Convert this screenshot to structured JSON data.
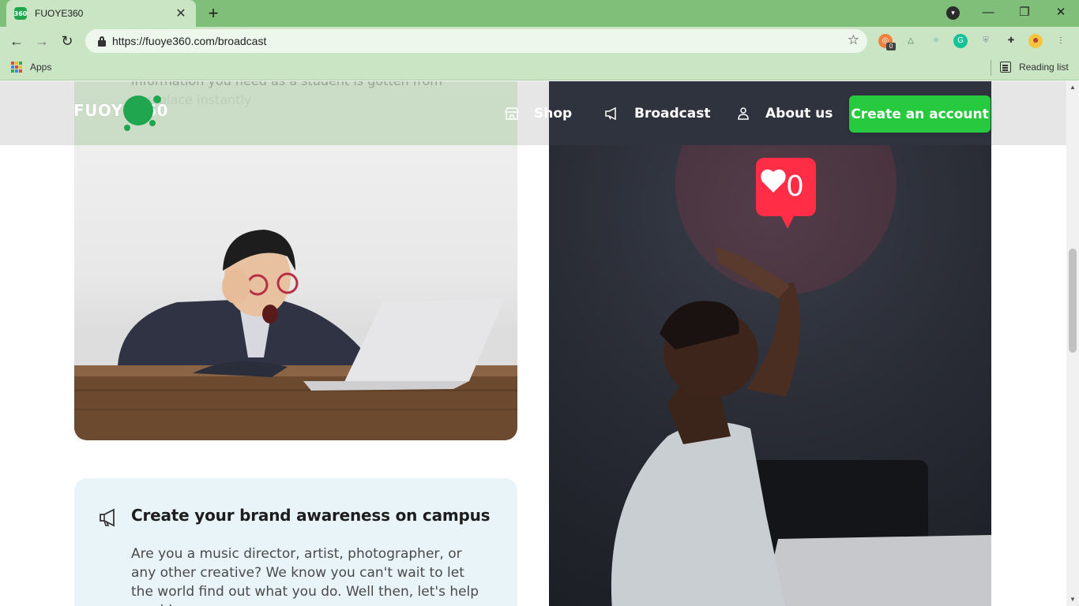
{
  "browser": {
    "tab_title": "FUOYE360",
    "tab_favicon_text": "360",
    "new_tab_label": "+",
    "close_tab_label": "✕",
    "url": "https://fuoye360.com/broadcast",
    "bookmarks": {
      "apps_label": "Apps",
      "reading_list_label": "Reading list"
    },
    "extension_badge": "0"
  },
  "header": {
    "logo_text": "FUOYE360",
    "nav": [
      {
        "label": "Shop",
        "icon": "store-icon"
      },
      {
        "label": "Broadcast",
        "icon": "megaphone-icon"
      },
      {
        "label": "About us",
        "icon": "user-icon"
      }
    ],
    "cta_label": "Create an account",
    "colors": {
      "accent": "#27c93f",
      "brand_green": "#21a650"
    }
  },
  "content": {
    "bleed_text_line1": "information you need as a student is gotten from",
    "bleed_text_line2": "one place instantly",
    "feature_card": {
      "title": "Create your brand awareness on campus",
      "body": "Are you a music director, artist, photographer, or any other creative? We know you can't wait to let the world find out what you do. Well then, let's help you blow your"
    },
    "like_notification_count": "0"
  }
}
